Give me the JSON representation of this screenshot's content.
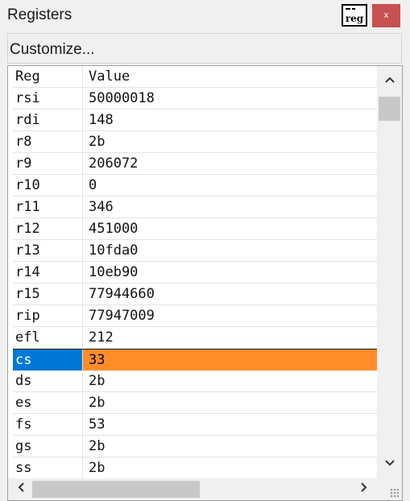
{
  "window": {
    "title": "Registers",
    "icon_text": "reg",
    "close_label": "x"
  },
  "toolbar": {
    "customize_label": "Customize..."
  },
  "table": {
    "headers": [
      "Reg",
      "Value"
    ],
    "rows": [
      {
        "reg": "rsi",
        "value": "50000018"
      },
      {
        "reg": "rdi",
        "value": "148"
      },
      {
        "reg": "r8",
        "value": "2b"
      },
      {
        "reg": "r9",
        "value": "206072"
      },
      {
        "reg": "r10",
        "value": "0"
      },
      {
        "reg": "r11",
        "value": "346"
      },
      {
        "reg": "r12",
        "value": "451000"
      },
      {
        "reg": "r13",
        "value": "10fda0"
      },
      {
        "reg": "r14",
        "value": "10eb90"
      },
      {
        "reg": "r15",
        "value": "77944660"
      },
      {
        "reg": "rip",
        "value": "77947009"
      },
      {
        "reg": "efl",
        "value": "212"
      },
      {
        "reg": "cs",
        "value": "33"
      },
      {
        "reg": "ds",
        "value": "2b"
      },
      {
        "reg": "es",
        "value": "2b"
      },
      {
        "reg": "fs",
        "value": "53"
      },
      {
        "reg": "gs",
        "value": "2b"
      },
      {
        "reg": "ss",
        "value": "2b"
      }
    ],
    "selected_index": 12
  },
  "scrollbars": {
    "up_icon": "^",
    "down_icon": "v",
    "left_icon": "<",
    "right_icon": ">"
  },
  "colors": {
    "selection_name_bg": "#0078d7",
    "selection_value_bg": "#ff8c29",
    "close_button_bg": "#c75050"
  }
}
